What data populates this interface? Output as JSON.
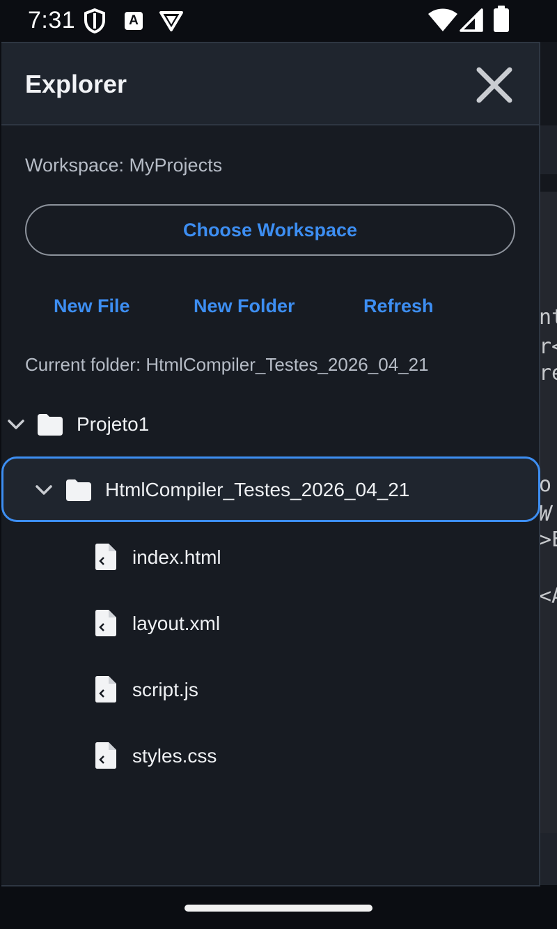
{
  "status_bar": {
    "time": "7:31",
    "icons": [
      "shield-icon",
      "translate-a-icon",
      "vpn-badge-icon",
      "wifi-icon",
      "cell-signal-icon",
      "battery-icon"
    ],
    "translate_letter": "A"
  },
  "drawer": {
    "title": "Explorer",
    "close_icon": "close-icon",
    "workspace_label": "Workspace: MyProjects",
    "choose_workspace_label": "Choose Workspace",
    "actions": {
      "new_file": "New File",
      "new_folder": "New Folder",
      "refresh": "Refresh"
    },
    "current_folder_label": "Current folder: HtmlCompiler_Testes_2026_04_21",
    "tree": [
      {
        "name": "Projeto1",
        "type": "folder",
        "expanded": true,
        "depth": 0,
        "selected": false
      },
      {
        "name": "HtmlCompiler_Testes_2026_04_21",
        "type": "folder",
        "expanded": true,
        "depth": 1,
        "selected": true
      },
      {
        "name": "index.html",
        "type": "file",
        "depth": 2
      },
      {
        "name": "layout.xml",
        "type": "file",
        "depth": 2
      },
      {
        "name": "script.js",
        "type": "file",
        "depth": 2
      },
      {
        "name": "styles.css",
        "type": "file",
        "depth": 2
      }
    ]
  },
  "background_editor": {
    "code_fragments": [
      "nt",
      "r<",
      "re",
      "o",
      "W",
      ">E",
      "<A"
    ]
  },
  "colors": {
    "accent": "#3d8ef2",
    "drawer_bg": "#171b22",
    "header_bg": "#1f252e",
    "text_primary": "#eef0f3",
    "text_secondary": "#b6bcc6"
  }
}
